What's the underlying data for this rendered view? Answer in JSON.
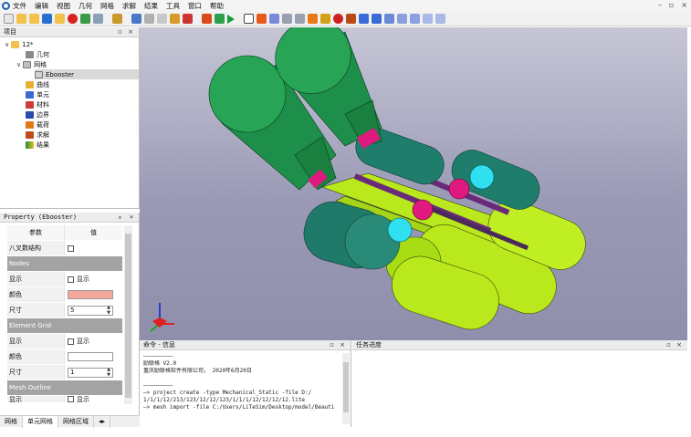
{
  "menubar": {
    "items": [
      "文件",
      "编辑",
      "视图",
      "几何",
      "网格",
      "求解",
      "结果",
      "工具",
      "窗口",
      "帮助"
    ],
    "minimize": "–",
    "restore": "▫",
    "close": "×"
  },
  "project_panel": {
    "title": "项目",
    "controls": "▫ ×",
    "tree": {
      "root": "12*",
      "geometry": "几何",
      "mesh": "网格",
      "mesh_child": "Ebooster",
      "curve": "曲线",
      "element": "单元",
      "material": "材料",
      "boundary": "边界",
      "load": "载荷",
      "solve": "求解",
      "result": "结果"
    }
  },
  "property_panel": {
    "title": "Property (Ebooster)",
    "controls": "▫ ×",
    "header": {
      "param": "参数",
      "value": "值"
    },
    "rows": {
      "octree": "八叉数结构",
      "nodes_group": "Nodes",
      "nodes_show": "显示",
      "nodes_show_value": "显示",
      "nodes_color": "颜色",
      "nodes_size": "尺寸",
      "nodes_size_value": "5",
      "element_grid_group": "Element Grid",
      "eg_show": "显示",
      "eg_show_value": "显示",
      "eg_color": "颜色",
      "eg_size": "尺寸",
      "eg_size_value": "1",
      "mesh_outline_group": "Mesh Outline",
      "mo_show": "显示",
      "mo_show_value": "显示"
    },
    "colors": {
      "nodes_color": "#f4a89a",
      "eg_color": "#ffffff"
    }
  },
  "left_tabs": {
    "tab1": "网格",
    "tab2": "单元网格",
    "tab3": "网格区域"
  },
  "cmd_panel": {
    "title": "命令 - 信息",
    "controls": "▫ ×",
    "lines": [
      "—————————",
      "励联格 V2.0",
      "重庆励联格软件有限公司， 2020年6月20日",
      "",
      "—————————",
      "—> project create -type Mechanical_Static -file D:/",
      "1/1/1/12/213/123/12/12/123/1/1/1/12/12/12/12.lite",
      "—> mesh import -file C:/Users/LiTeSim/Desktop/model/Beauti"
    ]
  },
  "task_panel": {
    "title": "任务进度",
    "controls": "▫ ×"
  },
  "colors": {
    "nozzle_green": "#1e8f4a",
    "dark_teal": "#1f7d6c",
    "lime": "#b9e81c",
    "magenta": "#e0197e",
    "cyan": "#2fe0f0",
    "purple": "#6a2a7a",
    "viewport_top": "#c6c6d6",
    "viewport_bottom": "#8f8fac"
  }
}
